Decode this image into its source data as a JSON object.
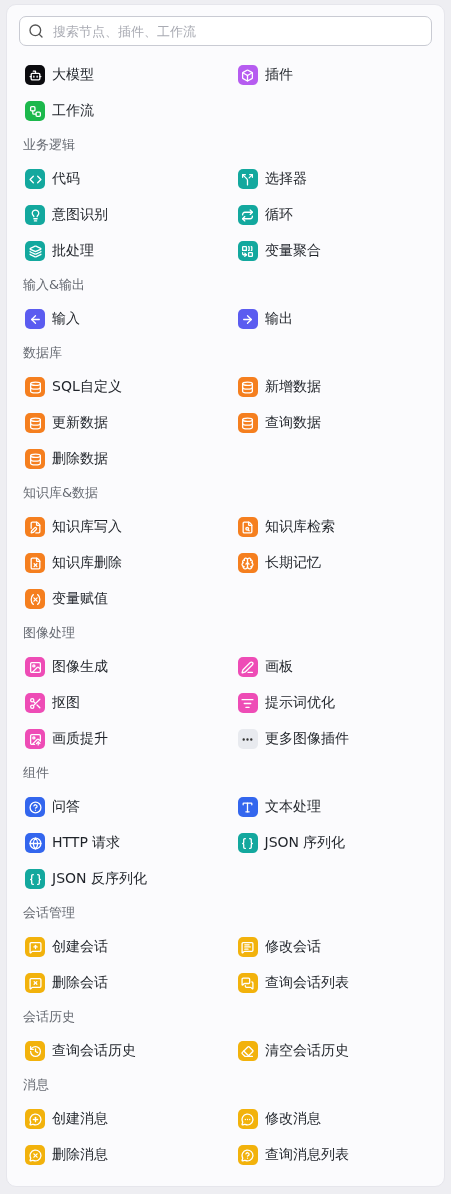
{
  "search": {
    "placeholder": "搜索节点、插件、工作流"
  },
  "sections": [
    {
      "items": [
        {
          "label": "大模型",
          "color": "#0b0b0f"
        },
        {
          "label": "插件",
          "color": "#b65cf0"
        },
        {
          "label": "工作流",
          "color": "#1cb84c"
        }
      ]
    },
    {
      "title": "业务逻辑",
      "items": [
        {
          "label": "代码",
          "color": "#13a89e"
        },
        {
          "label": "选择器",
          "color": "#13a89e"
        },
        {
          "label": "意图识别",
          "color": "#13a89e"
        },
        {
          "label": "循环",
          "color": "#13a89e"
        },
        {
          "label": "批处理",
          "color": "#13a89e"
        },
        {
          "label": "变量聚合",
          "color": "#13a89e"
        }
      ]
    },
    {
      "title": "输入&输出",
      "items": [
        {
          "label": "输入",
          "color": "#5b5cf0"
        },
        {
          "label": "输出",
          "color": "#5b5cf0"
        }
      ]
    },
    {
      "title": "数据库",
      "items": [
        {
          "label": "SQL自定义",
          "color": "#f57f1f"
        },
        {
          "label": "新增数据",
          "color": "#f57f1f"
        },
        {
          "label": "更新数据",
          "color": "#f57f1f"
        },
        {
          "label": "查询数据",
          "color": "#f57f1f"
        },
        {
          "label": "删除数据",
          "color": "#f57f1f"
        }
      ]
    },
    {
      "title": "知识库&数据",
      "items": [
        {
          "label": "知识库写入",
          "color": "#f57f1f"
        },
        {
          "label": "知识库检索",
          "color": "#f57f1f"
        },
        {
          "label": "知识库删除",
          "color": "#f57f1f"
        },
        {
          "label": "长期记忆",
          "color": "#f57f1f"
        },
        {
          "label": "变量赋值",
          "color": "#f57f1f"
        }
      ]
    },
    {
      "title": "图像处理",
      "items": [
        {
          "label": "图像生成",
          "color": "#ee4cb6"
        },
        {
          "label": "画板",
          "color": "#ee4cb6"
        },
        {
          "label": "抠图",
          "color": "#ee4cb6"
        },
        {
          "label": "提示词优化",
          "color": "#ee4cb6"
        },
        {
          "label": "画质提升",
          "color": "#ee4cb6"
        },
        {
          "label": "更多图像插件",
          "color": "#e8eaef"
        }
      ]
    },
    {
      "title": "组件",
      "items": [
        {
          "label": "问答",
          "color": "#3366ee"
        },
        {
          "label": "文本处理",
          "color": "#3366ee"
        },
        {
          "label": "HTTP 请求",
          "color": "#3366ee"
        },
        {
          "label": "JSON 序列化",
          "color": "#13a89e"
        },
        {
          "label": "JSON 反序列化",
          "color": "#13a89e"
        }
      ]
    },
    {
      "title": "会话管理",
      "items": [
        {
          "label": "创建会话",
          "color": "#f2b20c"
        },
        {
          "label": "修改会话",
          "color": "#f2b20c"
        },
        {
          "label": "删除会话",
          "color": "#f2b20c"
        },
        {
          "label": "查询会话列表",
          "color": "#f2b20c"
        }
      ]
    },
    {
      "title": "会话历史",
      "items": [
        {
          "label": "查询会话历史",
          "color": "#f2b20c"
        },
        {
          "label": "清空会话历史",
          "color": "#f2b20c"
        }
      ]
    },
    {
      "title": "消息",
      "items": [
        {
          "label": "创建消息",
          "color": "#f2b20c"
        },
        {
          "label": "修改消息",
          "color": "#f2b20c"
        },
        {
          "label": "删除消息",
          "color": "#f2b20c"
        },
        {
          "label": "查询消息列表",
          "color": "#f2b20c"
        }
      ]
    }
  ]
}
